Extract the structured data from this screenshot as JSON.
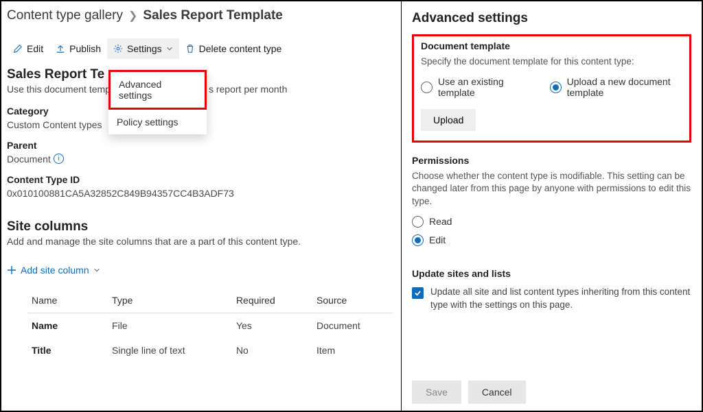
{
  "breadcrumb": {
    "parent": "Content type gallery",
    "current": "Sales Report Template"
  },
  "commands": {
    "edit": "Edit",
    "publish": "Publish",
    "settings": "Settings",
    "delete": "Delete content type"
  },
  "settingsMenu": {
    "advanced": "Advanced settings",
    "policy": "Policy settings"
  },
  "main": {
    "title": "Sales Report Te",
    "desc_pre": "Use this document temp",
    "desc_post": "s report per month",
    "category_lbl": "Category",
    "category_val": "Custom Content types",
    "parent_lbl": "Parent",
    "parent_val": "Document",
    "ctid_lbl": "Content Type ID",
    "ctid_val": "0x010100881CA5A32852C849B94357CC4B3ADF73"
  },
  "site_columns": {
    "title": "Site columns",
    "desc": "Add and manage the site columns that are a part of this content type.",
    "add": "Add site column",
    "headers": {
      "name": "Name",
      "type": "Type",
      "required": "Required",
      "source": "Source"
    },
    "rows": [
      {
        "name": "Name",
        "type": "File",
        "required": "Yes",
        "source": "Document"
      },
      {
        "name": "Title",
        "type": "Single line of text",
        "required": "No",
        "source": "Item"
      }
    ]
  },
  "panel": {
    "title": "Advanced settings",
    "doc": {
      "heading": "Document template",
      "desc": "Specify the document template for this content type:",
      "opt_existing": "Use an existing template",
      "opt_upload": "Upload a new document template",
      "upload_btn": "Upload"
    },
    "perm": {
      "heading": "Permissions",
      "desc": "Choose whether the content type is modifiable. This setting can be changed later from this page by anyone with permissions to edit this type.",
      "opt_read": "Read",
      "opt_edit": "Edit"
    },
    "update": {
      "heading": "Update sites and lists",
      "label": "Update all site and list content types inheriting from this content type with the settings on this page."
    },
    "save": "Save",
    "cancel": "Cancel"
  }
}
